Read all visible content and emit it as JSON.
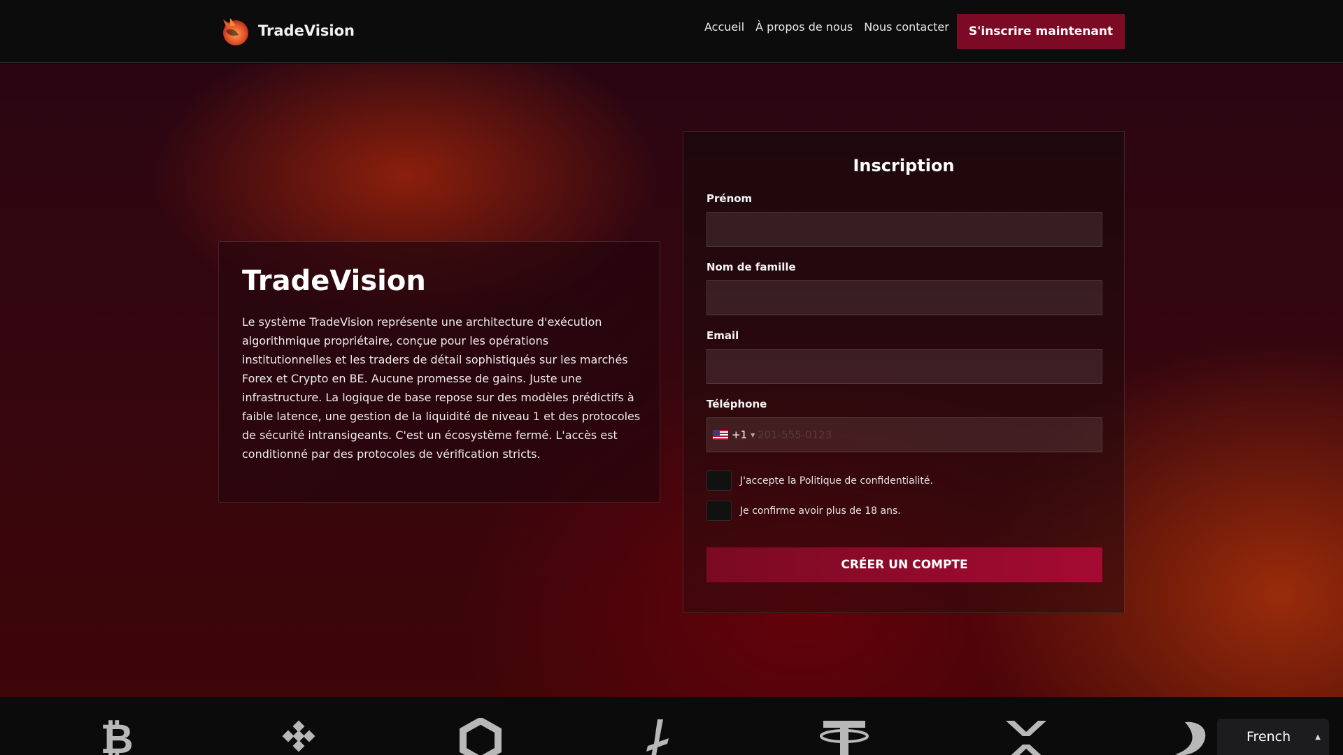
{
  "header": {
    "brand": "TradeVision",
    "nav": [
      "Accueil",
      "À propos de nous",
      "Nous contacter"
    ],
    "cta": "S'inscrire maintenant"
  },
  "about": {
    "title": "TradeVision",
    "text": "Le système TradeVision représente une architecture d'exécution algorithmique propriétaire, conçue pour les opérations institutionnelles et les traders de détail sophistiqués sur les marchés Forex et Crypto en BE. Aucune promesse de gains. Juste une infrastructure. La logique de base repose sur des modèles prédictifs à faible latence, une gestion de la liquidité de niveau 1 et des protocoles de sécurité intransigeants. C'est un écosystème fermé. L'accès est conditionné par des protocoles de vérification stricts."
  },
  "form": {
    "title": "Inscription",
    "first_name_label": "Prénom",
    "last_name_label": "Nom de famille",
    "email_label": "Email",
    "phone_label": "Téléphone",
    "phone_code": "+1",
    "phone_placeholder": "201-555-0123",
    "privacy_label": "J'accepte la Politique de confidentialité.",
    "age_label": "Je confirme avoir plus de 18 ans.",
    "submit": "CRÉER UN COMPTE"
  },
  "crypto_icons": [
    "bitcoin-icon",
    "binance-icon",
    "chainlink-icon",
    "litecoin-icon",
    "tether-icon",
    "xrp-icon",
    "dash-icon"
  ],
  "language": {
    "selected": "French"
  },
  "colors": {
    "accent": "#7c0a24",
    "background": "#0c0c0d"
  }
}
